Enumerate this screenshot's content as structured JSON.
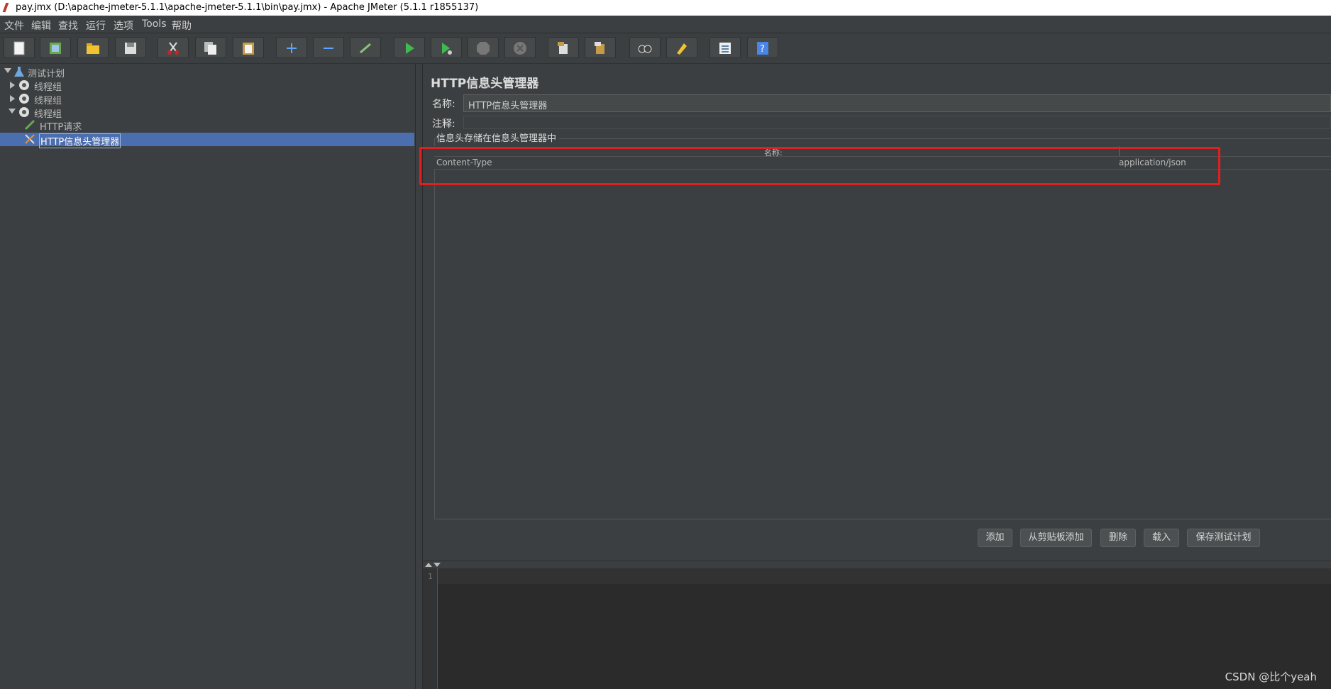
{
  "window": {
    "title": "pay.jmx (D:\\apache-jmeter-5.1.1\\apache-jmeter-5.1.1\\bin\\pay.jmx) - Apache JMeter (5.1.1 r1855137)"
  },
  "menu": [
    "文件",
    "编辑",
    "查找",
    "运行",
    "选项",
    "Tools",
    "帮助"
  ],
  "toolbar": {
    "buttons": [
      "new-icon",
      "templates-icon",
      "open-icon",
      "save-icon",
      "cut-icon",
      "copy-icon",
      "paste-icon",
      "expand-icon",
      "collapse-icon",
      "toggle-icon",
      "start-icon",
      "start-no-pause-icon",
      "stop-icon",
      "shutdown-icon",
      "clear-icon",
      "clear-all-icon",
      "search-icon",
      "reset-search-icon",
      "function-helper-icon",
      "help-icon"
    ]
  },
  "tree": {
    "root": "测试计划",
    "groups": [
      "线程组",
      "线程组",
      "线程组"
    ],
    "children": [
      "HTTP请求",
      "HTTP信息头管理器"
    ]
  },
  "panel": {
    "title": "HTTP信息头管理器",
    "name_label": "名称:",
    "name_value": "HTTP信息头管理器",
    "comment_label": "注释:",
    "section_title": "信息头存储在信息头管理器中",
    "columns": [
      "名称:"
    ],
    "rows": [
      {
        "name": "Content-Type",
        "value": "application/json"
      }
    ],
    "buttons": [
      "添加",
      "从剪贴板添加",
      "删除",
      "载入",
      "保存测试计划"
    ]
  },
  "editor": {
    "line_number": "1"
  },
  "watermark": "CSDN @比个yeah",
  "colors": {
    "background": "#3c3f41",
    "selection": "#4b6eaf",
    "highlight_box": "#e02020"
  }
}
